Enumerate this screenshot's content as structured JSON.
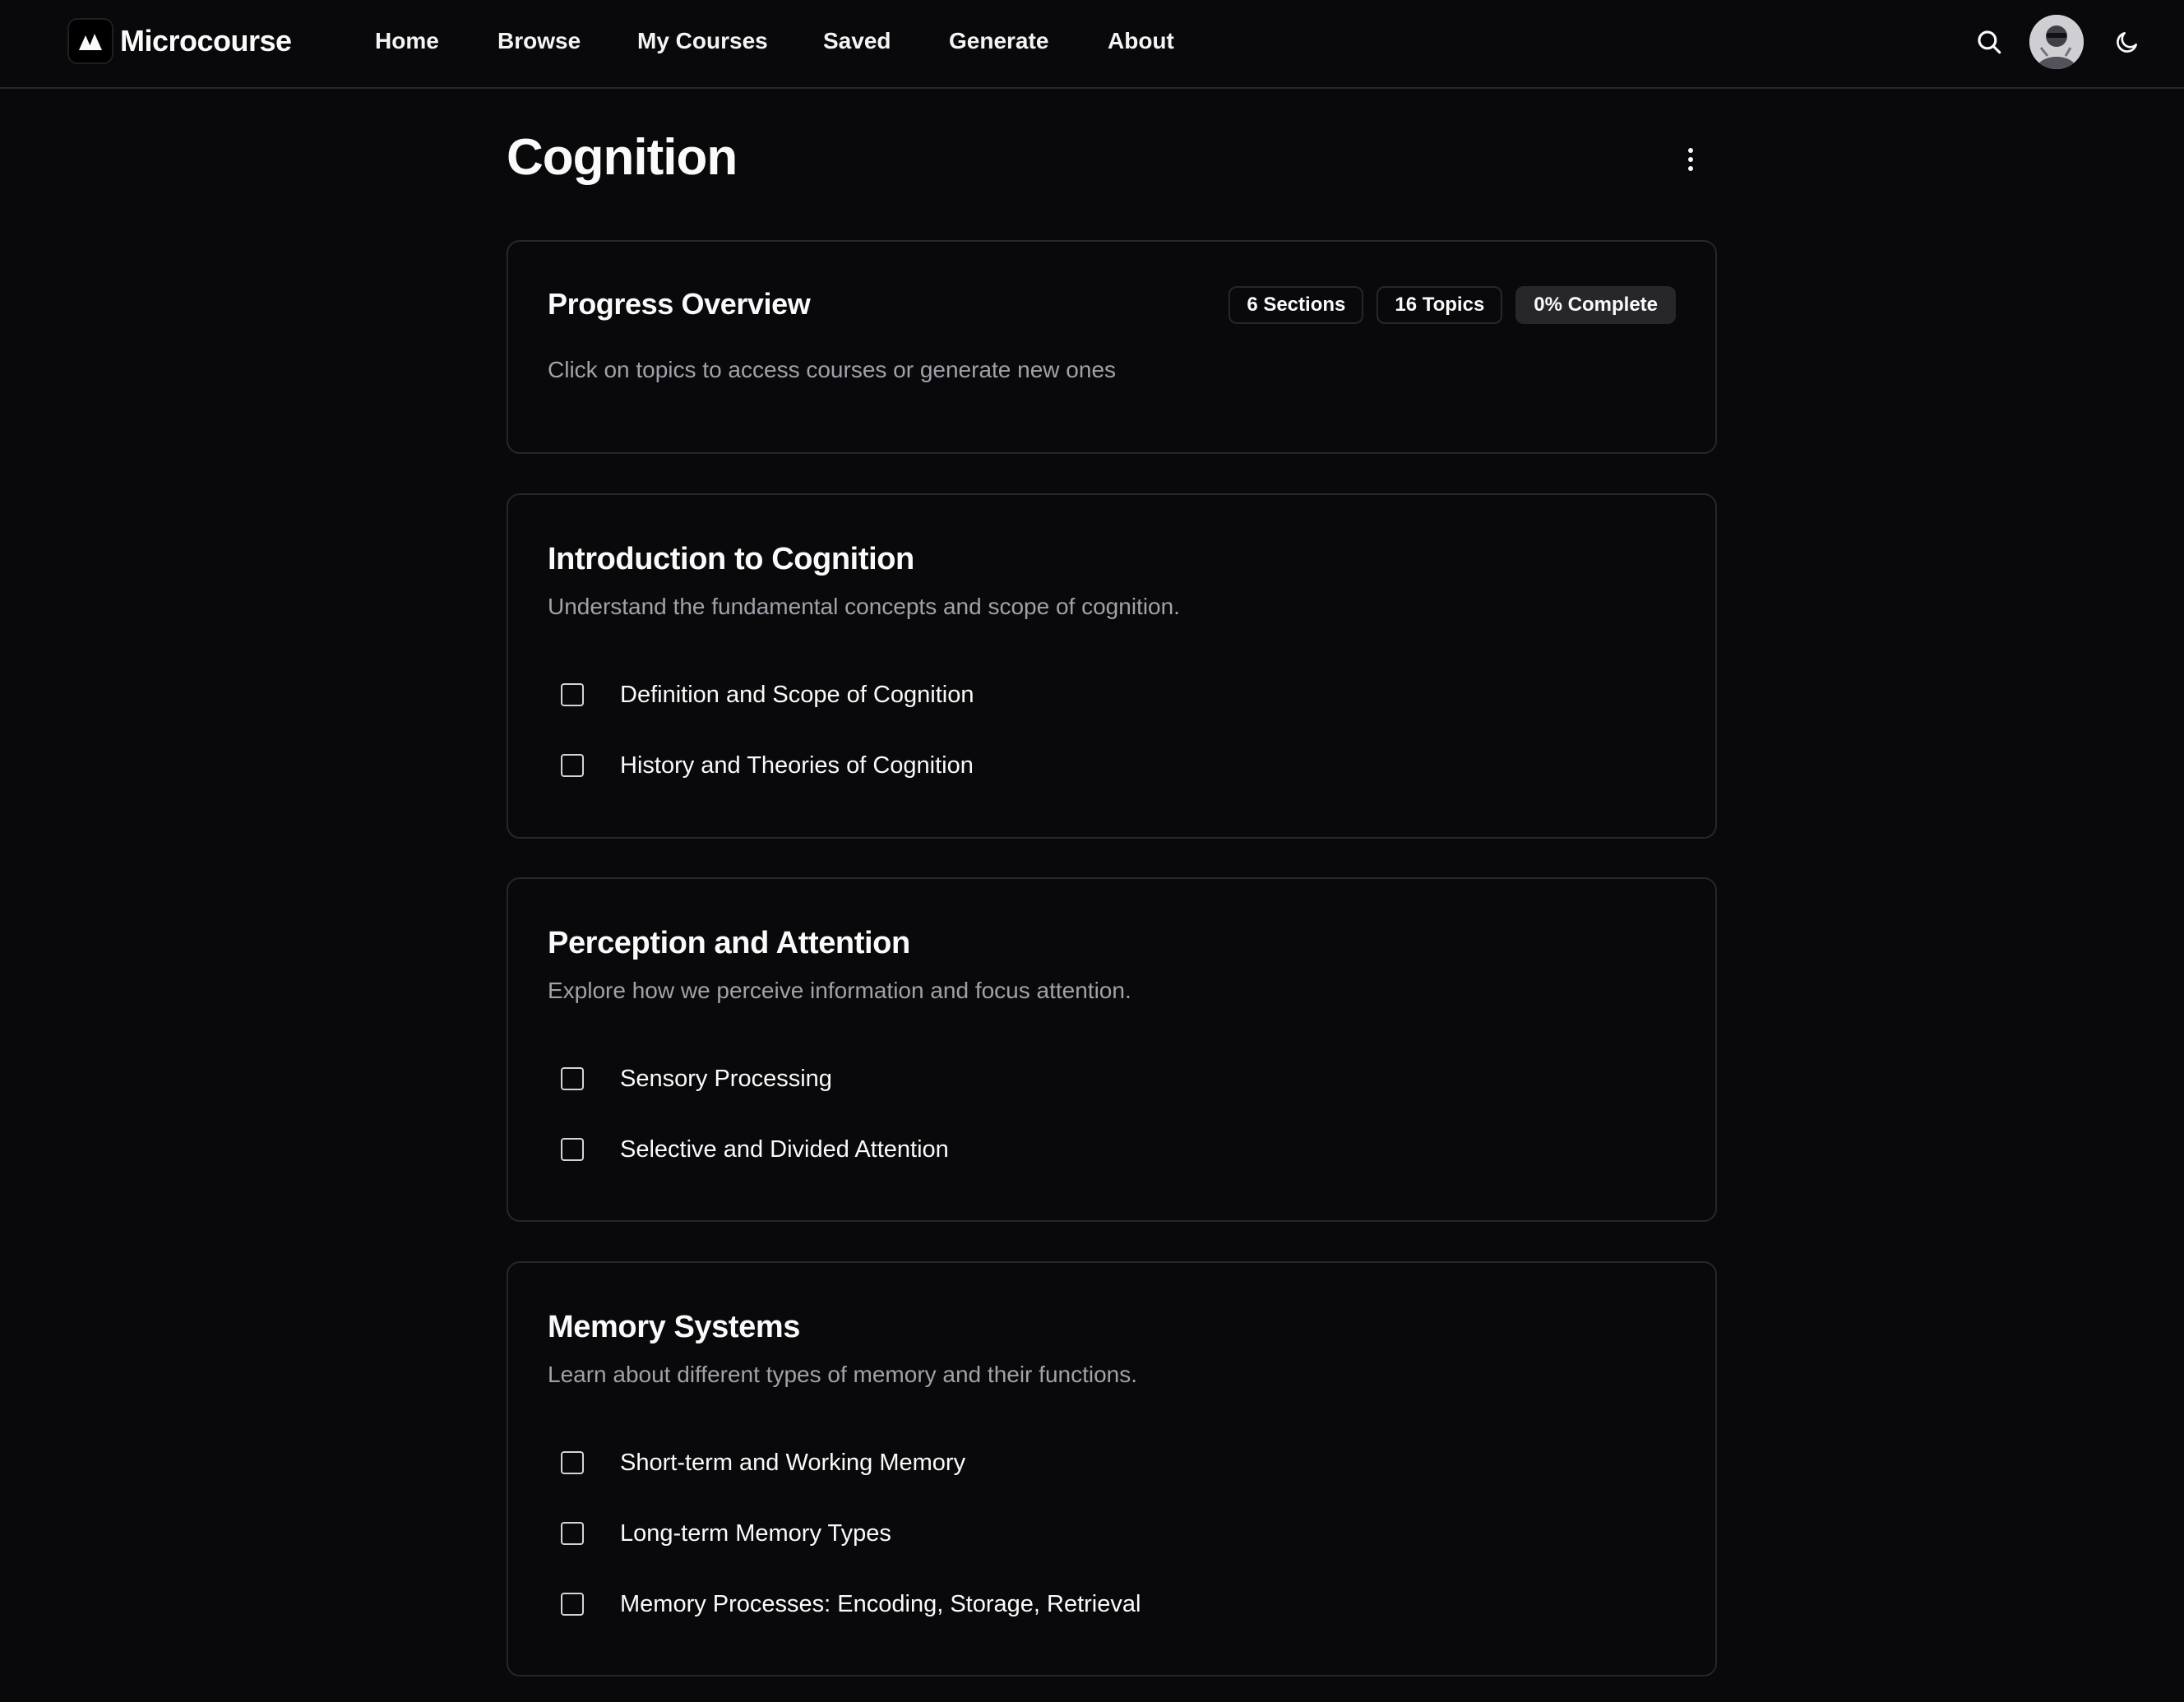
{
  "header": {
    "brand": "Microcourse",
    "nav": [
      "Home",
      "Browse",
      "My Courses",
      "Saved",
      "Generate",
      "About"
    ],
    "icons": {
      "logo": "mountain-logo-icon",
      "search": "search-icon",
      "avatar": "user-avatar",
      "theme": "moon-icon"
    }
  },
  "page": {
    "title": "Cognition",
    "menu_icon": "vertical-dots-icon"
  },
  "progress": {
    "title": "Progress Overview",
    "badges": {
      "sections": "6 Sections",
      "topics": "16 Topics",
      "complete": "0% Complete"
    },
    "description": "Click on topics to access courses or generate new ones"
  },
  "sections": [
    {
      "title": "Introduction to Cognition",
      "description": "Understand the fundamental concepts and scope of cognition.",
      "topics": [
        "Definition and Scope of Cognition",
        "History and Theories of Cognition"
      ]
    },
    {
      "title": "Perception and Attention",
      "description": "Explore how we perceive information and focus attention.",
      "topics": [
        "Sensory Processing",
        "Selective and Divided Attention"
      ]
    },
    {
      "title": "Memory Systems",
      "description": "Learn about different types of memory and their functions.",
      "topics": [
        "Short-term and Working Memory",
        "Long-term Memory Types",
        "Memory Processes: Encoding, Storage, Retrieval"
      ]
    }
  ],
  "colors": {
    "background": "#09090b",
    "border": "#27272a",
    "text": "#fafafa",
    "muted": "#a1a1aa"
  }
}
